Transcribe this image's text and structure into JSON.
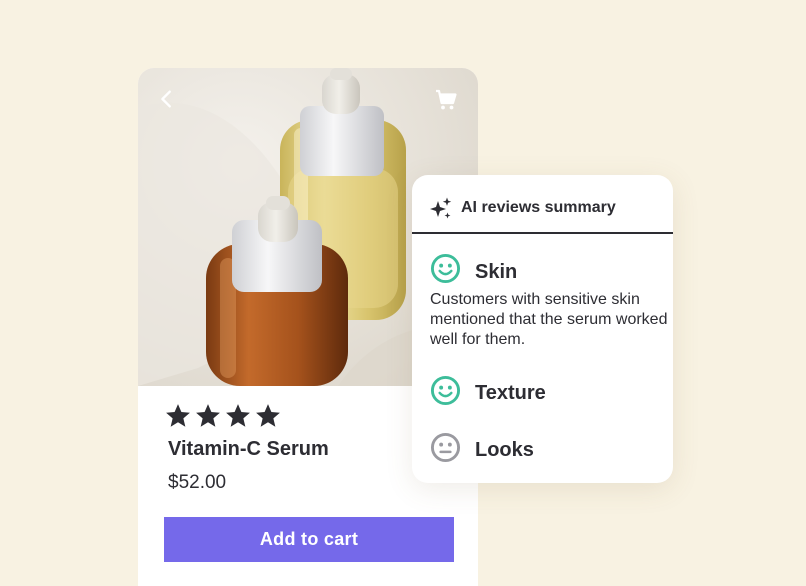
{
  "colors": {
    "background": "#f8f2e2",
    "accent": "#7569ea",
    "positive": "#3dbd9a",
    "neutral": "#9a9aa0",
    "text": "#2d2d33"
  },
  "product": {
    "back_icon": "chevron-left-icon",
    "cart_icon": "shopping-cart-icon",
    "rating": 4,
    "rating_max": 4,
    "name": "Vitamin-C Serum",
    "price": "$52.00",
    "add_to_cart_label": "Add to cart"
  },
  "reviews_summary": {
    "icon": "sparkle-icon",
    "title": "AI reviews summary",
    "aspects": [
      {
        "label": "Skin",
        "sentiment": "positive",
        "icon": "smiley-happy-icon",
        "description": "Customers with sensitive skin mentioned that the serum worked well for them."
      },
      {
        "label": "Texture",
        "sentiment": "positive",
        "icon": "smiley-happy-icon"
      },
      {
        "label": "Looks",
        "sentiment": "neutral",
        "icon": "smiley-neutral-icon"
      }
    ]
  }
}
